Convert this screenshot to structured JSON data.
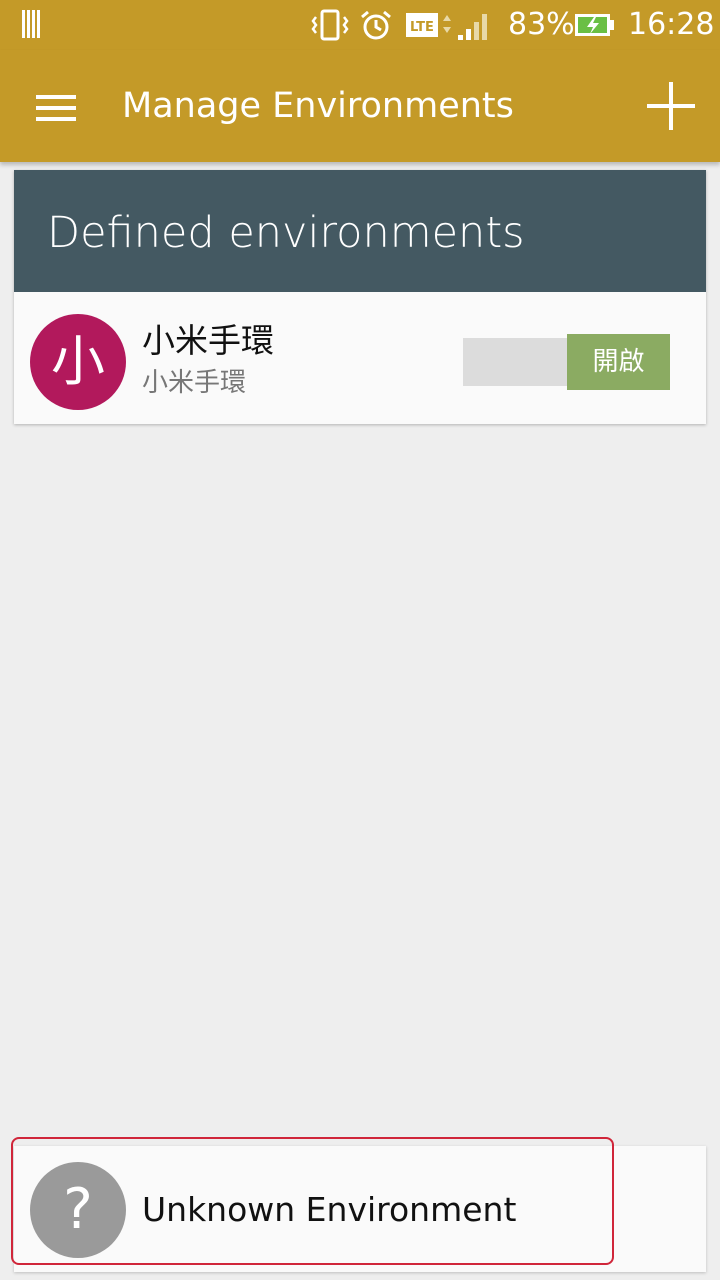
{
  "status_bar": {
    "battery_percent": "83%",
    "time": "16:28",
    "network": "LTE"
  },
  "app_bar": {
    "title": "Manage Environments",
    "menu_icon": "hamburger-menu-icon",
    "add_icon": "plus-icon"
  },
  "card": {
    "header": "Defined environments",
    "items": [
      {
        "avatar_letter": "小",
        "name": "小米手環",
        "subtitle": "小米手環",
        "toggle_label": "開啟",
        "avatar_color": "#b2195c"
      }
    ]
  },
  "unknown": {
    "icon_glyph": "?",
    "label": "Unknown Environment"
  },
  "colors": {
    "primary": "#c49a28",
    "header": "#445962",
    "toggle_on": "#8bab62"
  }
}
